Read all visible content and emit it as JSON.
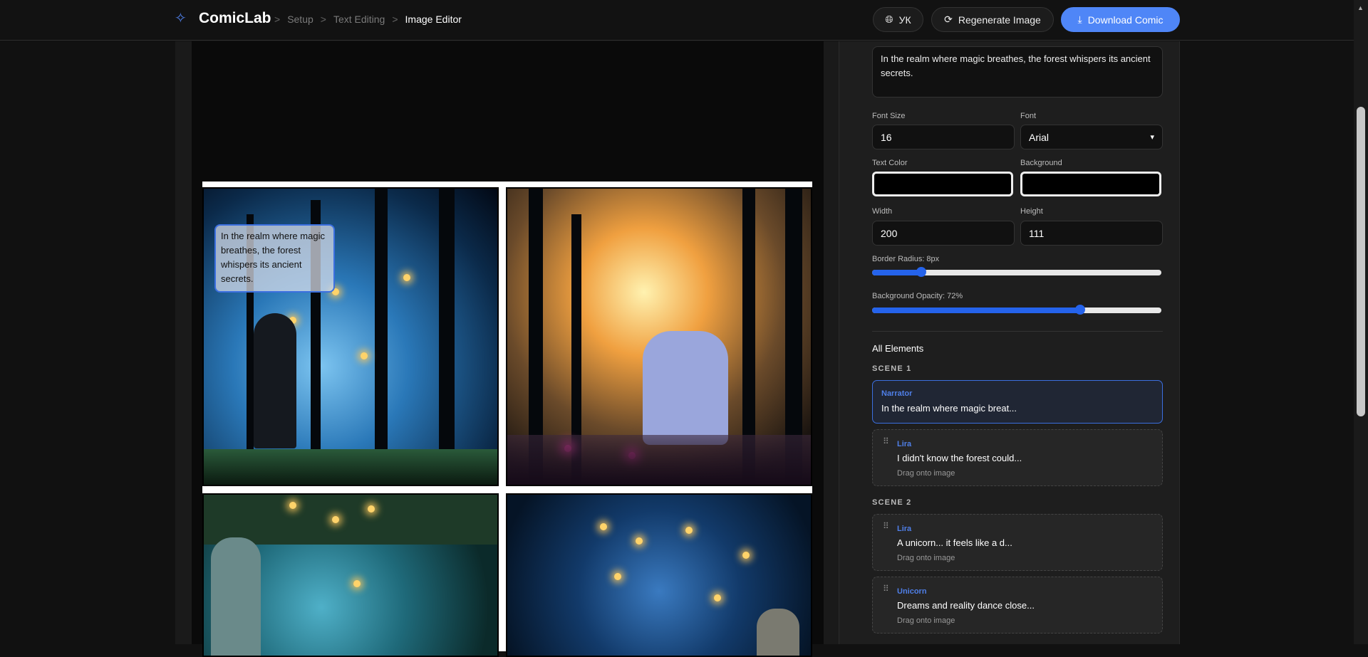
{
  "header": {
    "brand": "ComicLab",
    "breadcrumbs": [
      "Setup",
      "Text Editing",
      "Image Editor"
    ],
    "language_label": "УК",
    "regenerate_label": "Regenerate Image",
    "download_label": "Download Comic"
  },
  "canvas": {
    "bubble_text": "In the realm where magic breathes, the forest whispers its ancient secrets."
  },
  "editor": {
    "text_value": "In the realm where magic breathes, the forest whispers its ancient secrets.",
    "font_size_label": "Font Size",
    "font_size": "16",
    "font_label": "Font",
    "font": "Arial",
    "text_color_label": "Text Color",
    "text_color": "#000000",
    "background_label": "Background",
    "background_color": "#000000",
    "width_label": "Width",
    "width": "200",
    "height_label": "Height",
    "height": "111",
    "border_radius_label": "Border Radius: 8px",
    "border_radius_fraction": 0.17,
    "opacity_label": "Background Opacity: 72%",
    "opacity_fraction": 0.72
  },
  "elements": {
    "title": "All Elements",
    "scenes": [
      {
        "label": "SCENE 1",
        "items": [
          {
            "speaker": "Narrator",
            "text": "In the realm where magic breat...",
            "active": true
          },
          {
            "speaker": "Lira",
            "text": "I didn't know the forest could...",
            "hint": "Drag onto image"
          }
        ]
      },
      {
        "label": "SCENE 2",
        "items": [
          {
            "speaker": "Lira",
            "text": "A unicorn... it feels like a d...",
            "hint": "Drag onto image"
          },
          {
            "speaker": "Unicorn",
            "text": "Dreams and reality dance close...",
            "hint": "Drag onto image"
          }
        ]
      }
    ]
  },
  "colors": {
    "accent": "#4f86f7",
    "selected_border": "#3b6fe0"
  }
}
